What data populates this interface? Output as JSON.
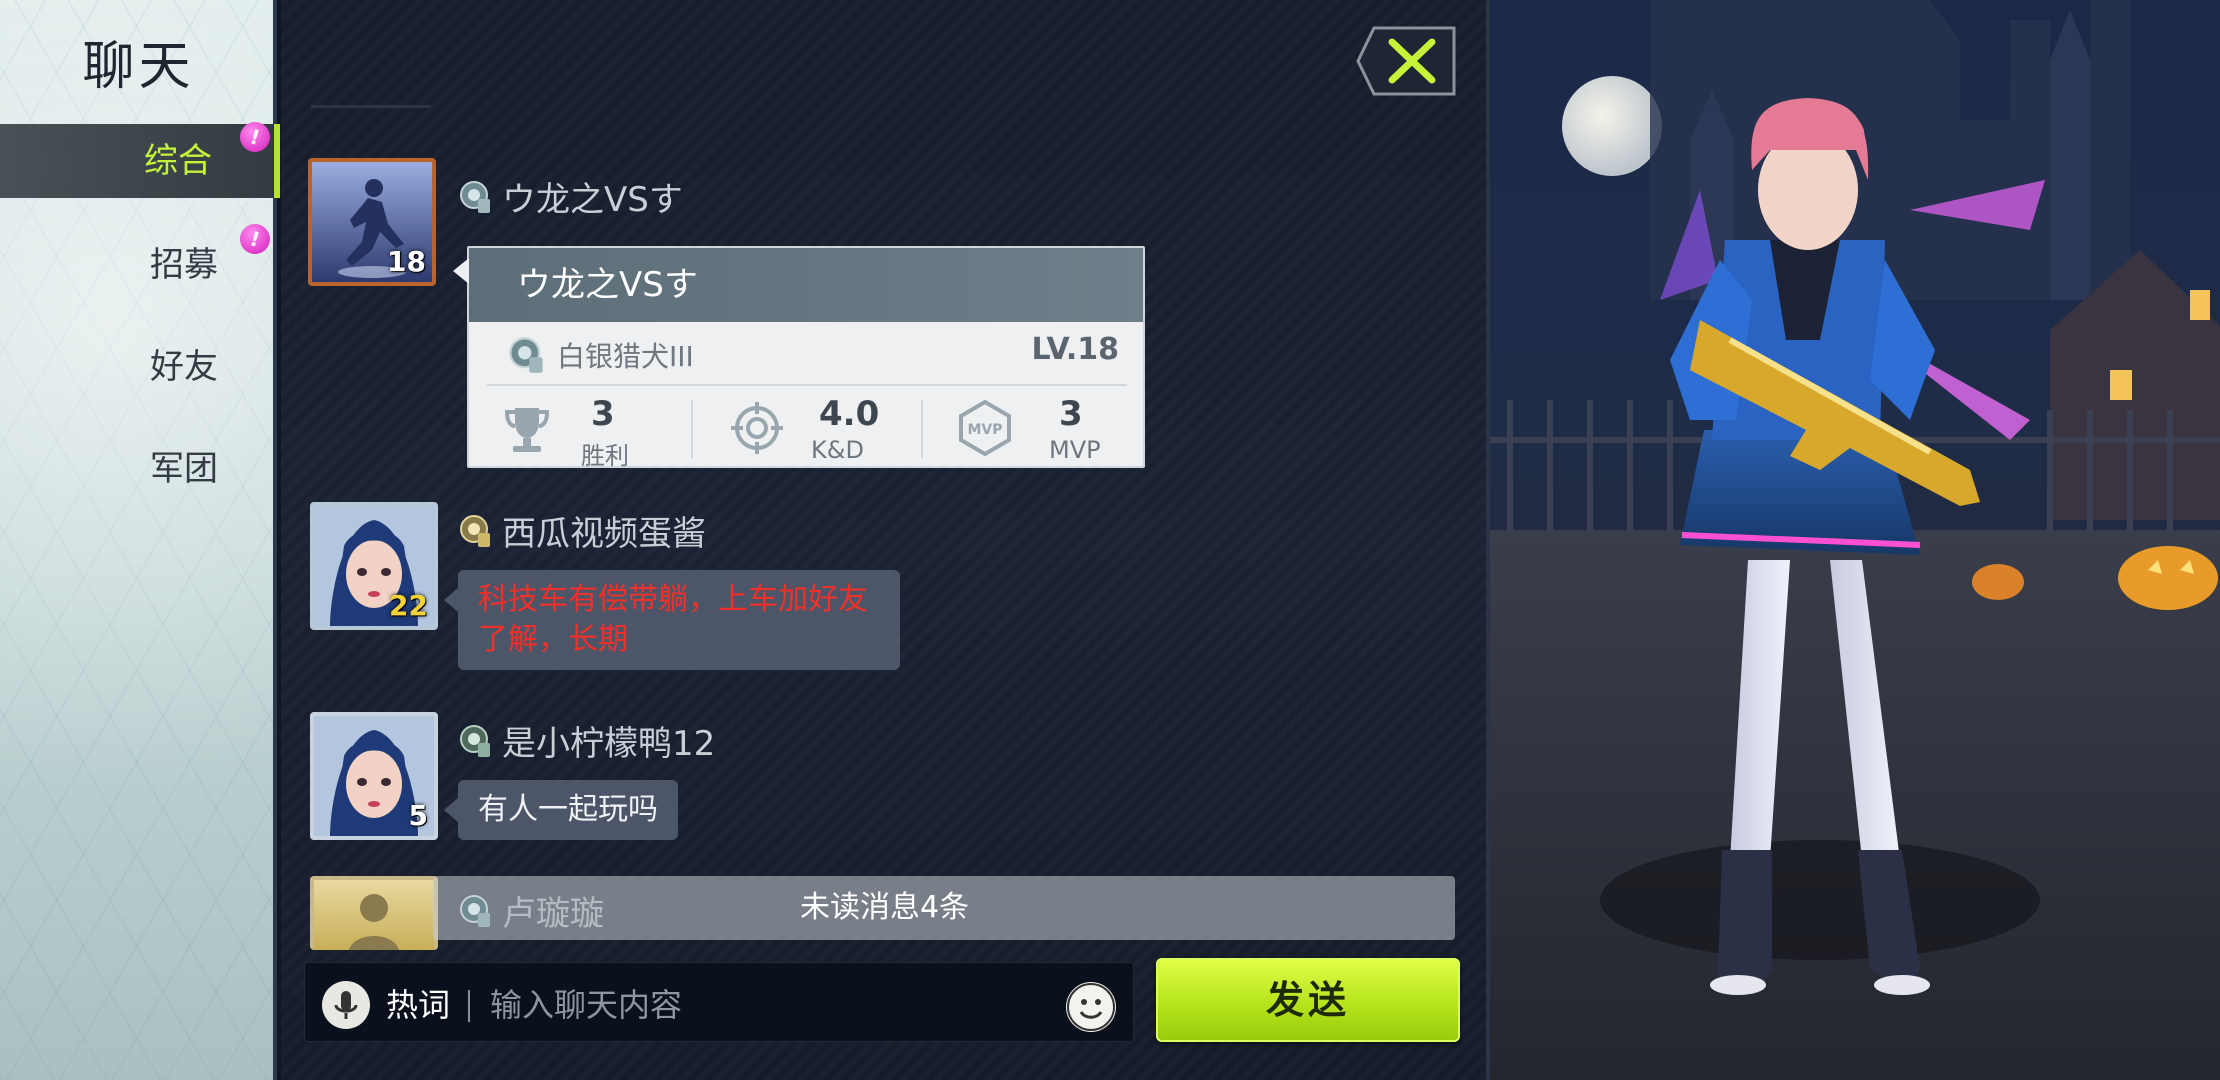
{
  "sidebar": {
    "title": "聊天",
    "items": [
      {
        "label": "综合",
        "badge": "!"
      },
      {
        "label": "招募",
        "badge": "!"
      },
      {
        "label": "好友"
      },
      {
        "label": "军团"
      }
    ]
  },
  "messages": [
    {
      "name": "ウ龙之VSす",
      "level": "18"
    },
    {
      "name": "西瓜视频蛋酱",
      "level": "22",
      "text": "科技车有偿带躺，上车加好友了解，长期"
    },
    {
      "name": "是小柠檬鸭12",
      "level": "5",
      "text": "有人一起玩吗"
    },
    {
      "name": "卢璇璇"
    }
  ],
  "profile_card": {
    "name": "ウ龙之VSす",
    "rank": "白银猎犬III",
    "level": "LV.18",
    "stats": [
      {
        "value": "3",
        "label": "胜利"
      },
      {
        "value": "4.0",
        "label": "K&D"
      },
      {
        "value": "3",
        "label": "MVP"
      }
    ],
    "mvp_icon_text": "MVP"
  },
  "unread": "未读消息4条",
  "input": {
    "hotword": "热词",
    "placeholder": "输入聊天内容"
  },
  "send_label": "发送",
  "colors": {
    "accent": "#c7f23a",
    "alert_text": "#f2302a",
    "badge": "#d21bb8"
  }
}
